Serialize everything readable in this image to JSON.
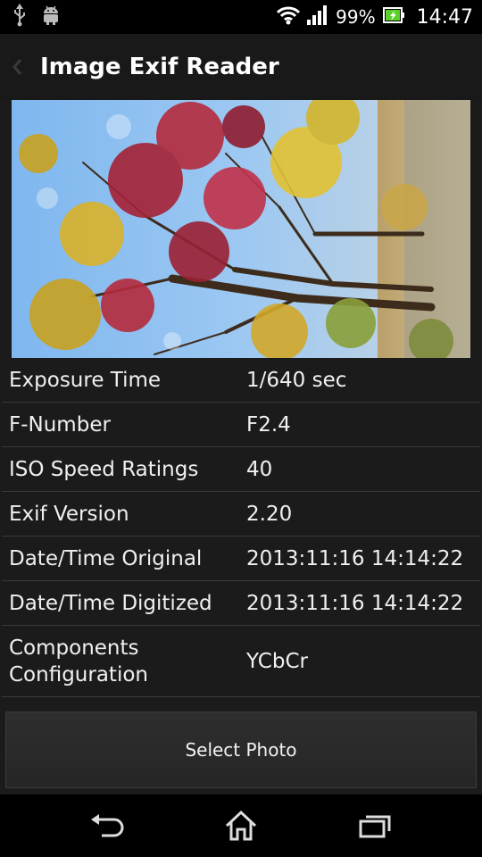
{
  "status_bar": {
    "battery": "99%",
    "time": "14:47",
    "icons": [
      "usb-icon",
      "android-debug-icon",
      "wifi-icon",
      "signal-icon",
      "battery-icon"
    ]
  },
  "action_bar": {
    "title": "Image Exif Reader",
    "up_icon": "chevron-left-icon"
  },
  "photo": {
    "description": "autumn-tree-photo"
  },
  "exif": {
    "rows": [
      {
        "label": "Exposure Time",
        "value": "1/640 sec"
      },
      {
        "label": "F-Number",
        "value": "F2.4"
      },
      {
        "label": "ISO Speed Ratings",
        "value": "40"
      },
      {
        "label": "Exif Version",
        "value": "2.20"
      },
      {
        "label": "Date/Time Original",
        "value": "2013:11:16 14:14:22"
      },
      {
        "label": "Date/Time Digitized",
        "value": "2013:11:16 14:14:22"
      },
      {
        "label_line1": "Components",
        "label_line2": "Configuration",
        "value": "YCbCr"
      }
    ]
  },
  "select_button": {
    "label": "Select Photo"
  },
  "nav_bar": {
    "icons": [
      "back-icon",
      "home-icon",
      "recent-apps-icon"
    ]
  }
}
